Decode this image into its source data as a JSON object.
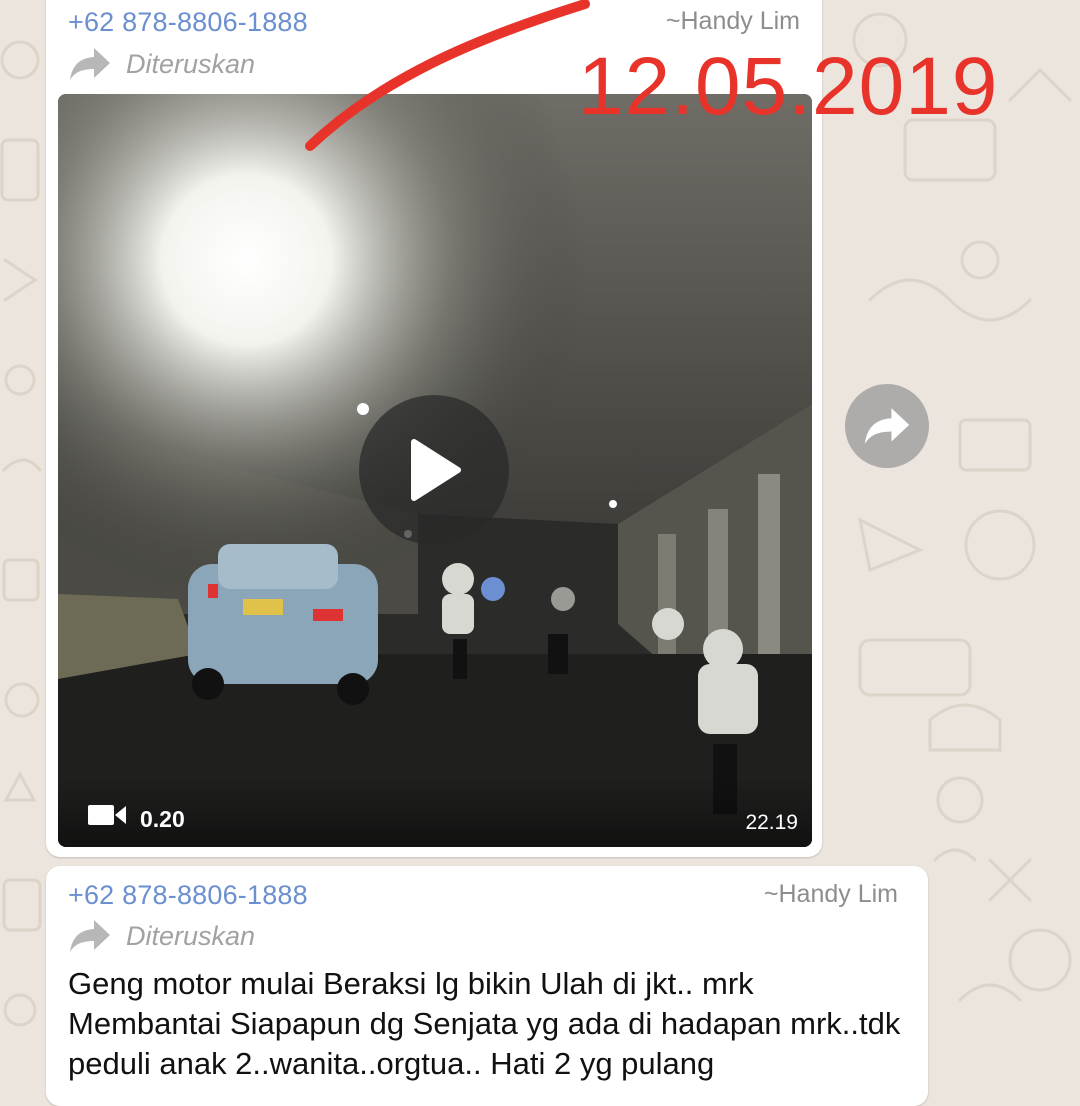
{
  "colors": {
    "wallpaper": "#ece5dd",
    "bubble": "#ffffff",
    "sender": "#6b8fd0",
    "stamp": "#e8332a"
  },
  "message1": {
    "sender_number": "+62 878-8806-1888",
    "push_name": "~Handy Lim",
    "forwarded_label": "Diteruskan",
    "forward_icon": "forward-arrow-icon",
    "video": {
      "duration": "0.20",
      "time": "22.19",
      "play_icon": "play-icon",
      "camera_icon": "video-camera-icon"
    }
  },
  "overlay_date_stamp": "12.05.2019",
  "share_icon": "share-forward-icon",
  "message2": {
    "sender_number": "+62 878-8806-1888",
    "push_name": "~Handy Lim",
    "forwarded_label": "Diteruskan",
    "text": "Geng motor mulai Beraksi lg bikin Ulah di jkt.. mrk Membantai Siapapun dg Senjata yg ada di hadapan mrk..tdk peduli anak 2..wanita..orgtua.. Hati 2 yg pulang"
  }
}
